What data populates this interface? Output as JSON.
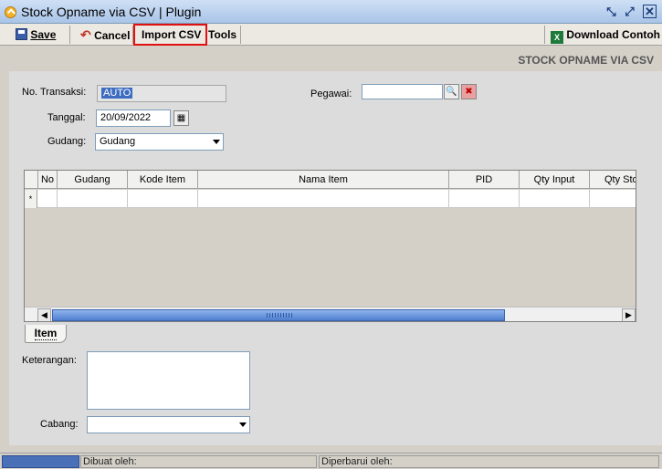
{
  "window": {
    "title": "Stock Opname via CSV | Plugin"
  },
  "toolbar": {
    "save_label": "Save",
    "cancel_label": "Cancel",
    "import_label": "Import CSV",
    "tools_label": "Tools",
    "download_label": "Download Contoh"
  },
  "form": {
    "title": "STOCK OPNAME VIA CSV",
    "no_transaksi_label": "No. Transaksi:",
    "no_transaksi_value": "AUTO",
    "tanggal_label": "Tanggal:",
    "tanggal_value": "20/09/2022",
    "gudang_label": "Gudang:",
    "gudang_value": "Gudang",
    "pegawai_label": "Pegawai:",
    "pegawai_value": "",
    "keterangan_label": "Keterangan:",
    "cabang_label": "Cabang:",
    "cabang_value": ""
  },
  "grid": {
    "columns": [
      "No",
      "Gudang",
      "Kode Item",
      "Nama Item",
      "PID",
      "Qty Input",
      "Qty Sto"
    ],
    "new_row_marker": "*"
  },
  "tabs": {
    "item_label": "Item"
  },
  "status": {
    "dibuat_oleh": "Dibuat oleh:",
    "diperbarui_oleh": "Diperbarui oleh:"
  },
  "colors": {
    "highlight": "#e01010",
    "title_gradient_top": "#cfe0f5",
    "scroll_thumb": "#4f7fcf"
  },
  "icons": {
    "title": "app-logo-icon",
    "save": "floppy-icon",
    "cancel": "undo-arrow-icon",
    "download": "excel-icon",
    "search": "search-icon",
    "clear": "clear-icon",
    "calendar": "calendar-icon"
  }
}
